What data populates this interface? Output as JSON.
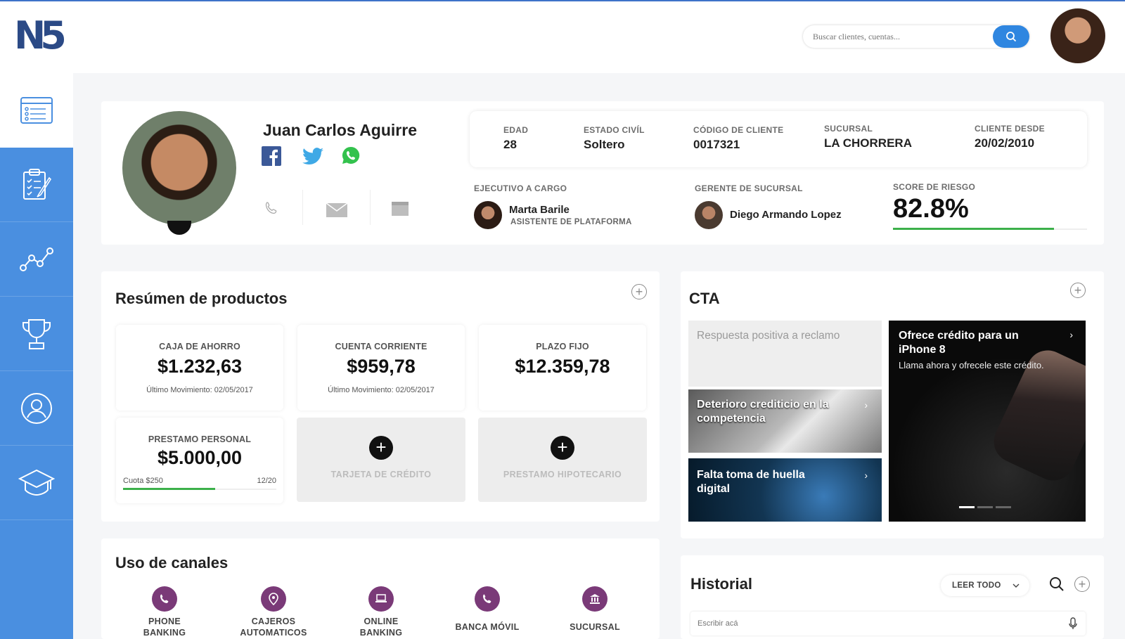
{
  "brand": {
    "logo_text": "N5"
  },
  "search": {
    "placeholder": "Buscar clientes, cuentas..."
  },
  "client": {
    "name": "Juan Carlos Aguirre",
    "info": [
      {
        "label": "EDAD",
        "value": "28"
      },
      {
        "label": "ESTADO CIVÍL",
        "value": "Soltero"
      },
      {
        "label": "CÓDIGO DE CLIENTE",
        "value": "0017321"
      },
      {
        "label": "SUCURSAL",
        "value": "LA CHORRERA"
      },
      {
        "label": "CLIENTE DESDE",
        "value": "20/02/2010"
      }
    ],
    "executive": {
      "label": "EJECUTIVO A CARGO",
      "name": "Marta Barile",
      "role": "ASISTENTE DE PLATAFORMA"
    },
    "manager": {
      "label": "GERENTE DE SUCURSAL",
      "name": "Diego Armando Lopez"
    },
    "risk": {
      "label": "SCORE DE RIESGO",
      "value": "82.8%",
      "level": 0.828
    }
  },
  "products": {
    "title": "Resúmen de productos",
    "items": [
      {
        "label": "CAJA DE AHORRO",
        "value": "$1.232,63",
        "meta": "Último Movimiento: 02/05/2017"
      },
      {
        "label": "CUENTA CORRIENTE",
        "value": "$959,78",
        "meta": "Último Movimiento: 02/05/2017"
      },
      {
        "label": "PLAZO FIJO",
        "value": "$12.359,78",
        "meta": ""
      }
    ],
    "loan": {
      "label": "PRESTAMO PERSONAL",
      "value": "$5.000,00",
      "fee": "Cuota $250",
      "progress_text": "12/20",
      "progress": 0.6
    },
    "add": [
      {
        "label": "TARJETA DE CRÉDITO"
      },
      {
        "label": "PRESTAMO HIPOTECARIO"
      }
    ]
  },
  "channels": {
    "title": "Uso de canales",
    "items": [
      {
        "line1": "PHONE",
        "line2": "BANKING"
      },
      {
        "line1": "CAJEROS",
        "line2": "AUTOMATICOS"
      },
      {
        "line1": "ONLINE",
        "line2": "BANKING"
      },
      {
        "line1": "BANCA MÓVIL",
        "line2": ""
      },
      {
        "line1": "SUCURSAL",
        "line2": ""
      }
    ]
  },
  "cta": {
    "title": "CTA",
    "items": [
      {
        "title": "Respuesta positiva a reclamo"
      },
      {
        "title": "Deterioro crediticio en la competencia"
      },
      {
        "title": "Falta toma de huella digital"
      },
      {
        "title": "Ofrece crédito para un iPhone 8",
        "subtitle": "Llama ahora y ofrecele este crédito."
      }
    ]
  },
  "history": {
    "title": "Historial",
    "filter": "LEER TODO",
    "placeholder": "Escribir acá"
  },
  "colors": {
    "accent": "#4a8fe0",
    "search_button": "#2f86e0",
    "risk_bar": "#3cb04a",
    "channel_icon": "#7a3a78"
  }
}
